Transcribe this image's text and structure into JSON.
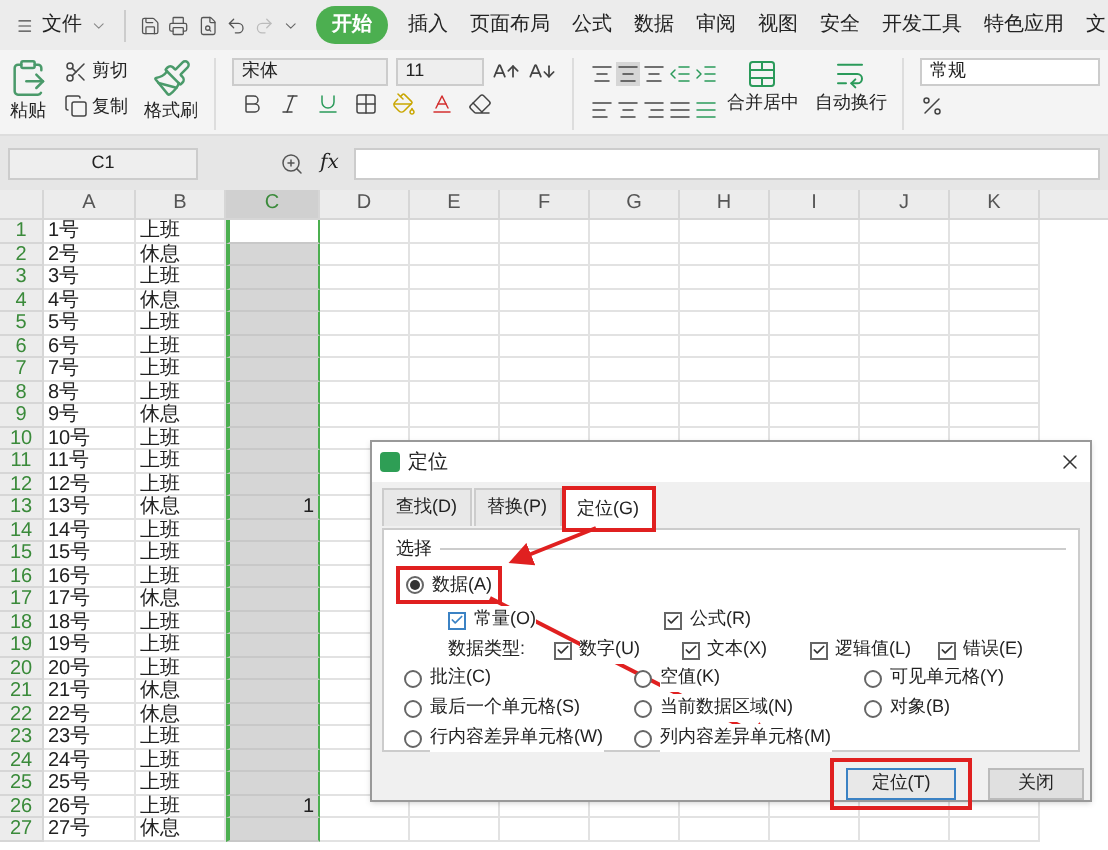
{
  "menu": {
    "file": "文件",
    "tabs": [
      {
        "label": "开始",
        "selected": true
      },
      {
        "label": "插入",
        "selected": false
      },
      {
        "label": "页面布局",
        "selected": false
      },
      {
        "label": "公式",
        "selected": false
      },
      {
        "label": "数据",
        "selected": false
      },
      {
        "label": "审阅",
        "selected": false
      },
      {
        "label": "视图",
        "selected": false
      },
      {
        "label": "安全",
        "selected": false
      },
      {
        "label": "开发工具",
        "selected": false
      },
      {
        "label": "特色应用",
        "selected": false
      },
      {
        "label": "文",
        "selected": false
      }
    ]
  },
  "ribbon": {
    "paste": "粘贴",
    "cut": "剪切",
    "copy": "复制",
    "format_painter": "格式刷",
    "font": "宋体",
    "font_size": "11",
    "merge": "合并居中",
    "wrap": "自动换行",
    "number_format": "常规"
  },
  "formula_bar": {
    "cell": "C1",
    "fx": "fx"
  },
  "sheet": {
    "columns": [
      {
        "label": "A",
        "selected": false
      },
      {
        "label": "B",
        "selected": false
      },
      {
        "label": "C",
        "selected": true
      },
      {
        "label": "D",
        "selected": false
      },
      {
        "label": "E",
        "selected": false
      },
      {
        "label": "F",
        "selected": false
      },
      {
        "label": "G",
        "selected": false
      },
      {
        "label": "H",
        "selected": false
      },
      {
        "label": "I",
        "selected": false
      },
      {
        "label": "J",
        "selected": false
      },
      {
        "label": "K",
        "selected": false
      }
    ],
    "rows": [
      {
        "n": "1",
        "a": "1号",
        "b": "上班"
      },
      {
        "n": "2",
        "a": "2号",
        "b": "休息"
      },
      {
        "n": "3",
        "a": "3号",
        "b": "上班"
      },
      {
        "n": "4",
        "a": "4号",
        "b": "休息"
      },
      {
        "n": "5",
        "a": "5号",
        "b": "上班"
      },
      {
        "n": "6",
        "a": "6号",
        "b": "上班"
      },
      {
        "n": "7",
        "a": "7号",
        "b": "上班"
      },
      {
        "n": "8",
        "a": "8号",
        "b": "上班"
      },
      {
        "n": "9",
        "a": "9号",
        "b": "休息"
      },
      {
        "n": "10",
        "a": "10号",
        "b": "上班"
      },
      {
        "n": "11",
        "a": "11号",
        "b": "上班"
      },
      {
        "n": "12",
        "a": "12号",
        "b": "上班"
      },
      {
        "n": "13",
        "a": "13号",
        "b": "休息",
        "c": "1"
      },
      {
        "n": "14",
        "a": "14号",
        "b": "上班"
      },
      {
        "n": "15",
        "a": "15号",
        "b": "上班"
      },
      {
        "n": "16",
        "a": "16号",
        "b": "上班"
      },
      {
        "n": "17",
        "a": "17号",
        "b": "休息"
      },
      {
        "n": "18",
        "a": "18号",
        "b": "上班"
      },
      {
        "n": "19",
        "a": "19号",
        "b": "上班"
      },
      {
        "n": "20",
        "a": "20号",
        "b": "上班"
      },
      {
        "n": "21",
        "a": "21号",
        "b": "休息"
      },
      {
        "n": "22",
        "a": "22号",
        "b": "休息"
      },
      {
        "n": "23",
        "a": "23号",
        "b": "上班"
      },
      {
        "n": "24",
        "a": "24号",
        "b": "上班"
      },
      {
        "n": "25",
        "a": "25号",
        "b": "上班"
      },
      {
        "n": "26",
        "a": "26号",
        "b": "上班",
        "c": "1"
      },
      {
        "n": "27",
        "a": "27号",
        "b": "休息"
      }
    ]
  },
  "dialog": {
    "title": "定位",
    "tabs": [
      {
        "label": "查找(D)",
        "selected": false
      },
      {
        "label": "替换(P)",
        "selected": false
      },
      {
        "label": "定位(G)",
        "selected": true
      }
    ],
    "group": "选择",
    "data_option": {
      "label": "数据(A)",
      "selected": true
    },
    "subchecks": [
      {
        "label": "常量(O)",
        "checked": true
      },
      {
        "label": "公式(R)",
        "checked": true
      }
    ],
    "types_label": "数据类型:",
    "types": [
      {
        "label": "数字(U)",
        "checked": true
      },
      {
        "label": "文本(X)",
        "checked": true
      },
      {
        "label": "逻辑值(L)",
        "checked": true
      },
      {
        "label": "错误(E)",
        "checked": true
      }
    ],
    "options": [
      {
        "label": "批注(C)",
        "selected": false
      },
      {
        "label": "空值(K)",
        "selected": false
      },
      {
        "label": "可见单元格(Y)",
        "selected": false
      },
      {
        "label": "最后一个单元格(S)",
        "selected": false
      },
      {
        "label": "当前数据区域(N)",
        "selected": false
      },
      {
        "label": "对象(B)",
        "selected": false
      },
      {
        "label": "行内容差异单元格(W)",
        "selected": false
      },
      {
        "label": "列内容差异单元格(M)",
        "selected": false
      }
    ],
    "buttons": [
      "定位(T)",
      "关闭"
    ]
  }
}
